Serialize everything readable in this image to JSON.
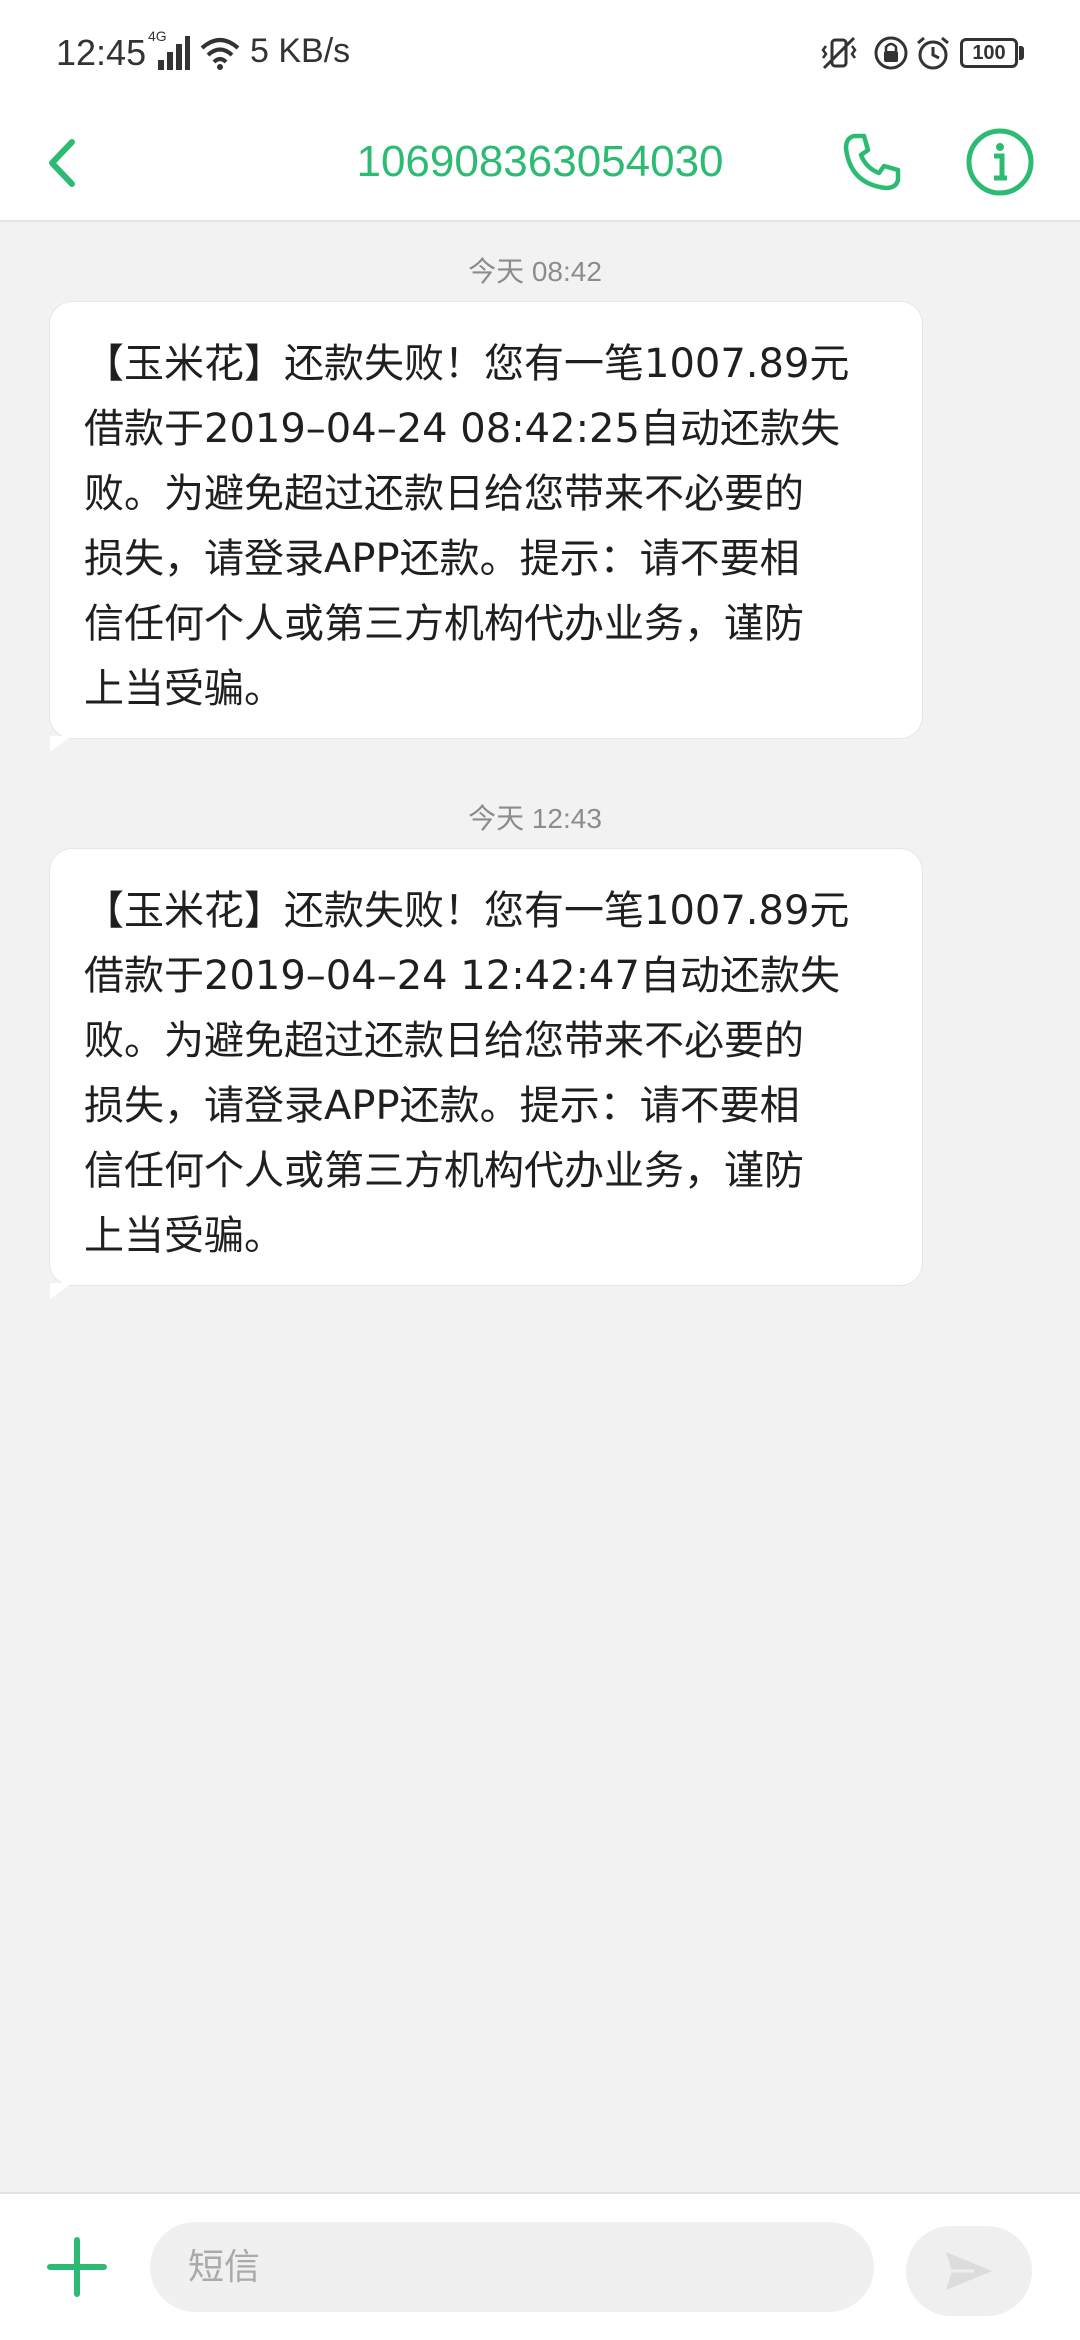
{
  "status_bar": {
    "time": "12:45",
    "network_type": "4G",
    "speed": "5 KB/s",
    "battery": "100",
    "icons": [
      "signal-icon",
      "wifi-icon",
      "vibrate-icon",
      "lock-rotation-icon",
      "alarm-icon",
      "battery-icon"
    ]
  },
  "header": {
    "title": "106908363054030",
    "icons": [
      "back-arrow-icon",
      "phone-icon",
      "info-icon"
    ],
    "accent_color": "#2dbb74"
  },
  "messages": [
    {
      "timestamp": "今天 08:42",
      "lines": [
        "【玉米花】还款失败！您有一笔1007.89元",
        "借款于2019–04–24 08:42:25自动还款失",
        "败。为避免超过还款日给您带来不必要的",
        "损失，请登录APP还款。提示：请不要相",
        "信任何个人或第三方机构代办业务，谨防",
        "上当受骗。"
      ]
    },
    {
      "timestamp": "今天 12:43",
      "lines": [
        "【玉米花】还款失败！您有一笔1007.89元",
        "借款于2019–04–24 12:42:47自动还款失",
        "败。为避免超过还款日给您带来不必要的",
        "损失，请登录APP还款。提示：请不要相",
        "信任何个人或第三方机构代办业务，谨防",
        "上当受骗。"
      ]
    }
  ],
  "composer": {
    "placeholder": "短信",
    "value": "",
    "icons": [
      "plus-icon",
      "send-icon"
    ]
  },
  "colors": {
    "background": "#f2f2f2",
    "bubble": "#ffffff",
    "accent": "#2dbb74"
  }
}
